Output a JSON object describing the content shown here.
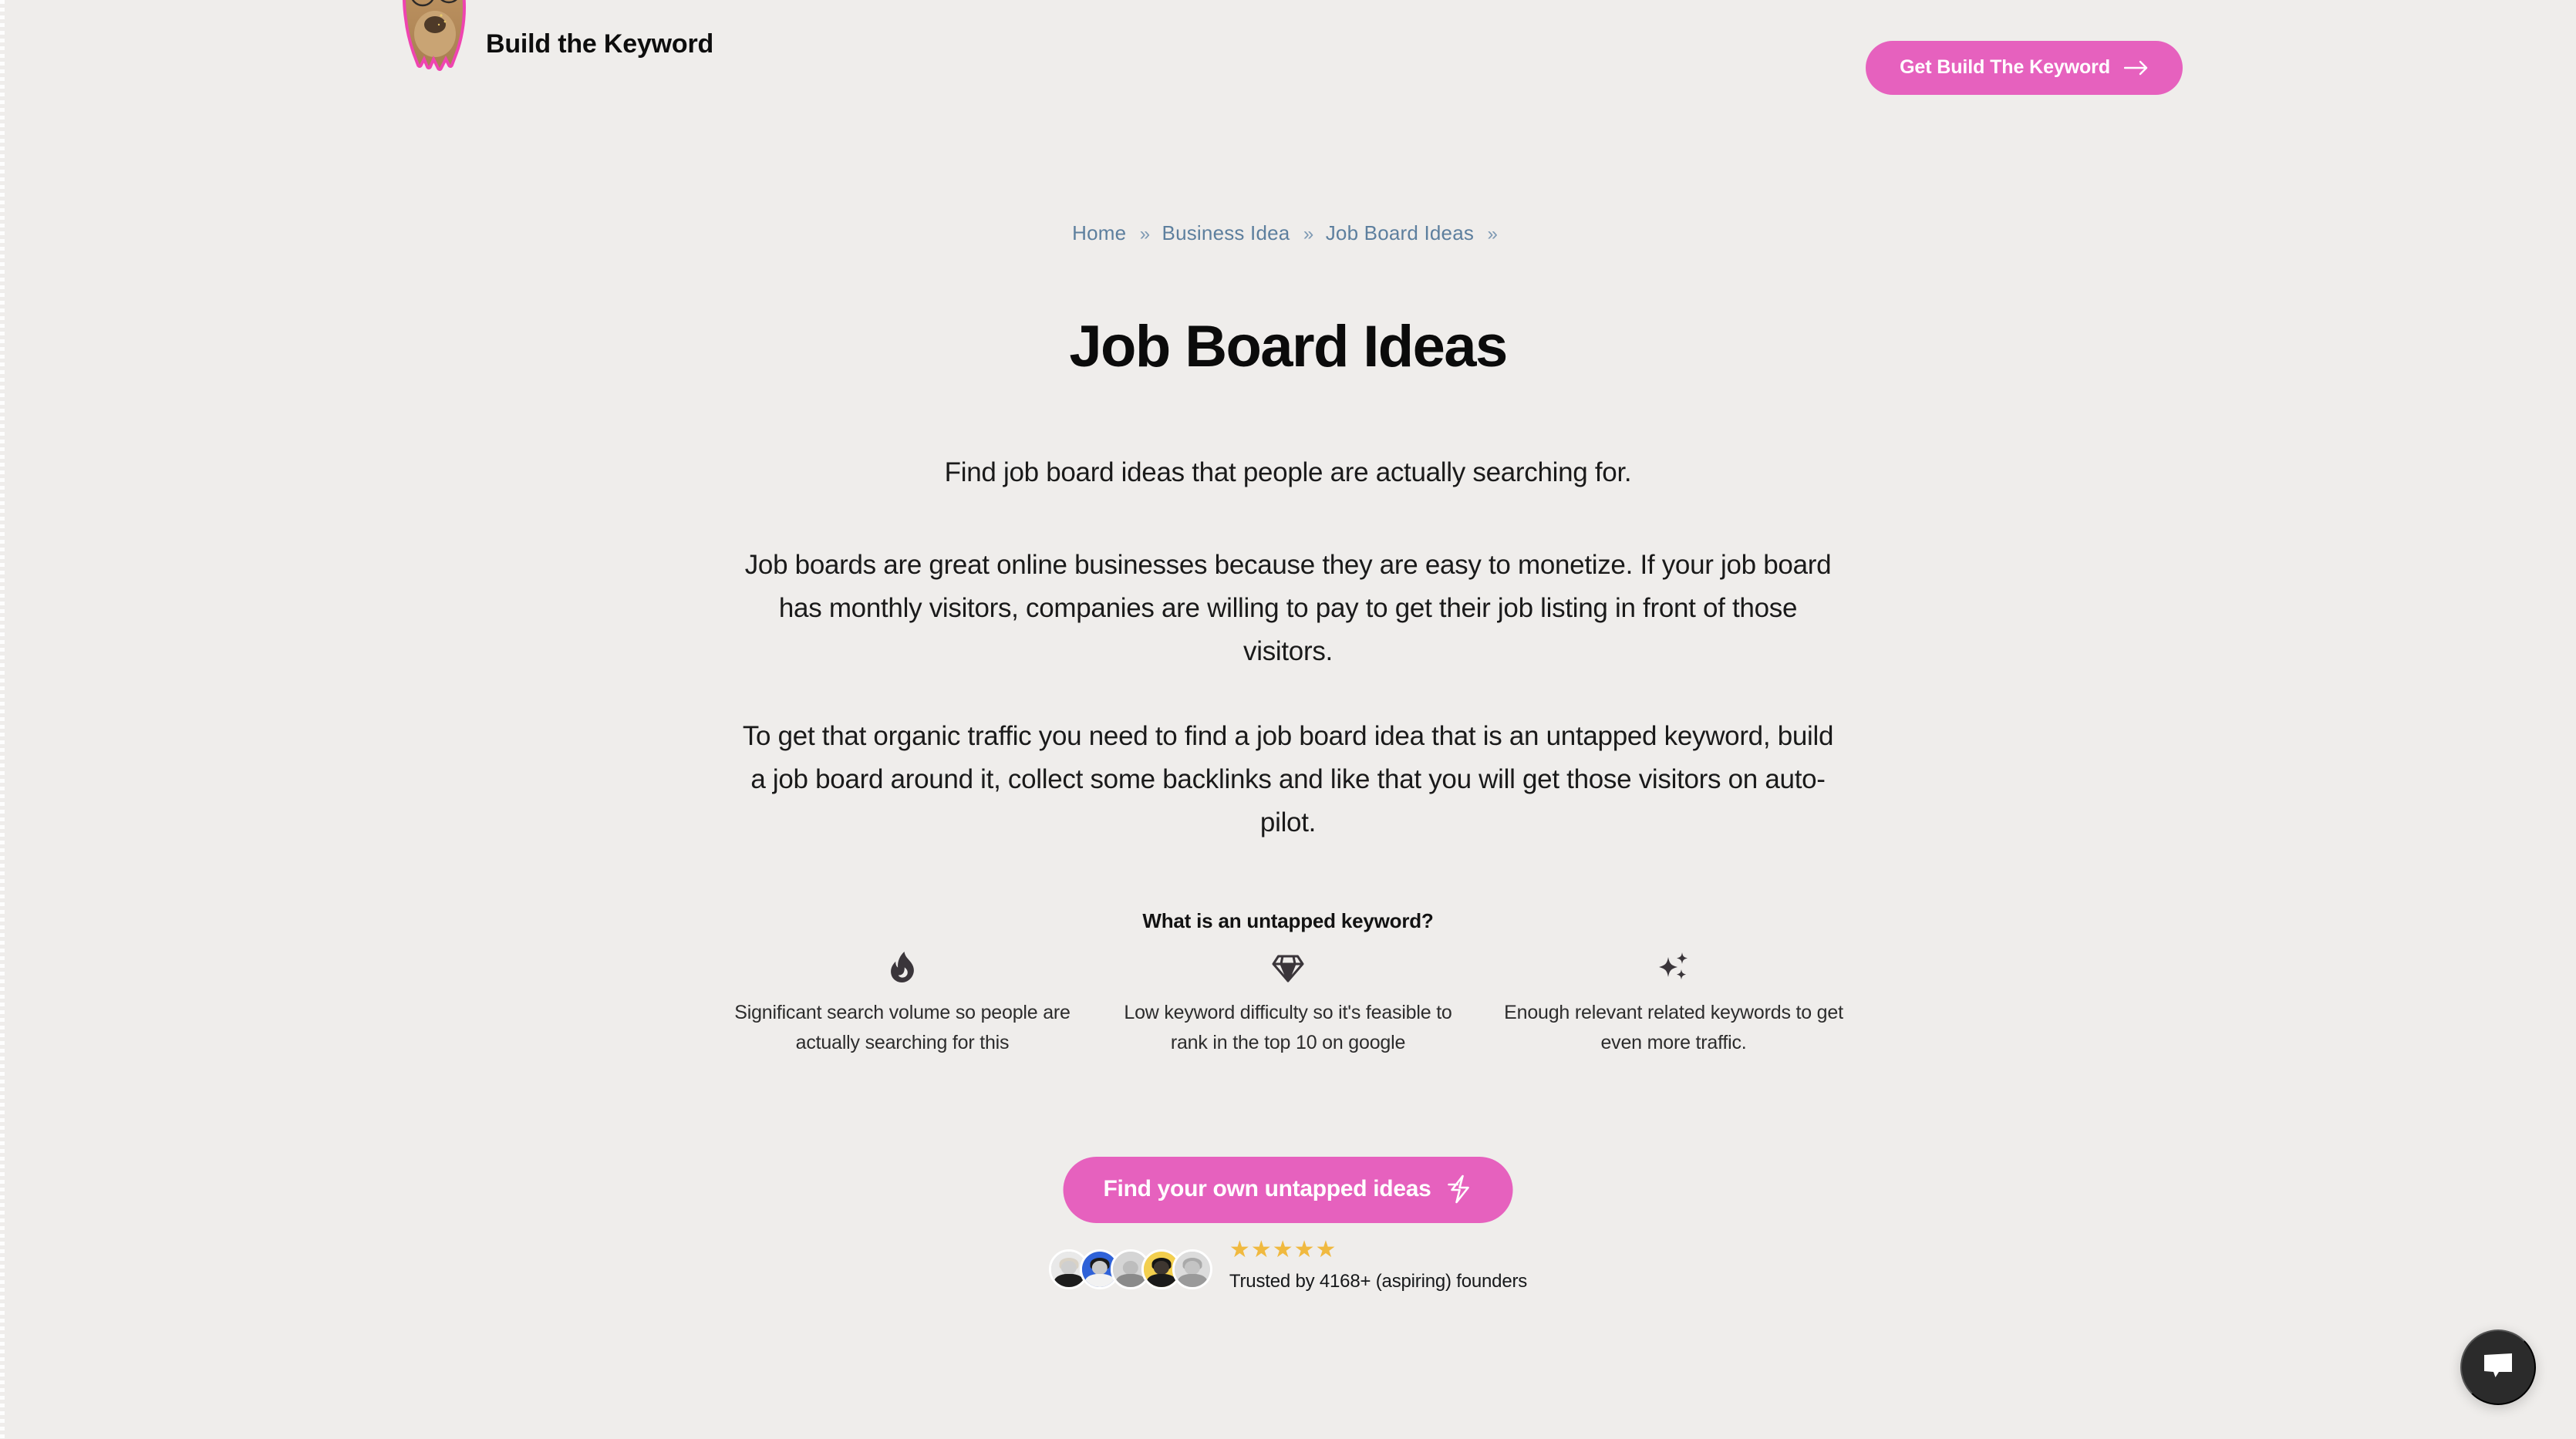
{
  "header": {
    "brand_name": "Build the Keyword",
    "logo_alt": "dog-logo",
    "cta_label": "Get Build The Keyword",
    "cta_icon": "arrow-right-icon"
  },
  "breadcrumb": {
    "items": [
      {
        "label": "Home"
      },
      {
        "label": "Business Idea"
      },
      {
        "label": "Job Board Ideas"
      }
    ],
    "separator": "»",
    "trailing_separator": "»"
  },
  "main": {
    "title": "Job Board Ideas",
    "lede": "Find job board ideas that people are actually searching for.",
    "paragraph_1": "Job boards are great online businesses because they are easy to monetize. If your job board has monthly visitors, companies are willing to pay to get their job listing in front of those visitors.",
    "paragraph_2": "To get that organic traffic you need to find a job board idea that is an untapped keyword, build a job board around it, collect some backlinks and like that you will get those visitors on auto-pilot."
  },
  "features": {
    "heading": "What is an untapped keyword?",
    "items": [
      {
        "icon": "flame-icon",
        "text": "Significant search volume so people are actually searching for this"
      },
      {
        "icon": "diamond-icon",
        "text": "Low keyword difficulty so it's feasible to rank in the top 10 on google"
      },
      {
        "icon": "sparkles-icon",
        "text": "Enough relevant related keywords to get even more traffic."
      }
    ]
  },
  "cta": {
    "label": "Find your own untapped ideas",
    "icon": "lightning-bolt-icon"
  },
  "social_proof": {
    "stars": "★★★★★",
    "star_count": 5,
    "trusted_text": "Trusted by 4168+ (aspiring) founders",
    "avatar_count": 5
  },
  "chat": {
    "icon": "chat-bubble-icon",
    "label": "Open chat"
  },
  "colors": {
    "background": "#efedeb",
    "accent_pink": "#e661be",
    "breadcrumb_blue": "#5d7f9e",
    "star_gold": "#f0b93f",
    "icon_dark": "#3a353a",
    "chat_dark": "#2b2b2b"
  }
}
